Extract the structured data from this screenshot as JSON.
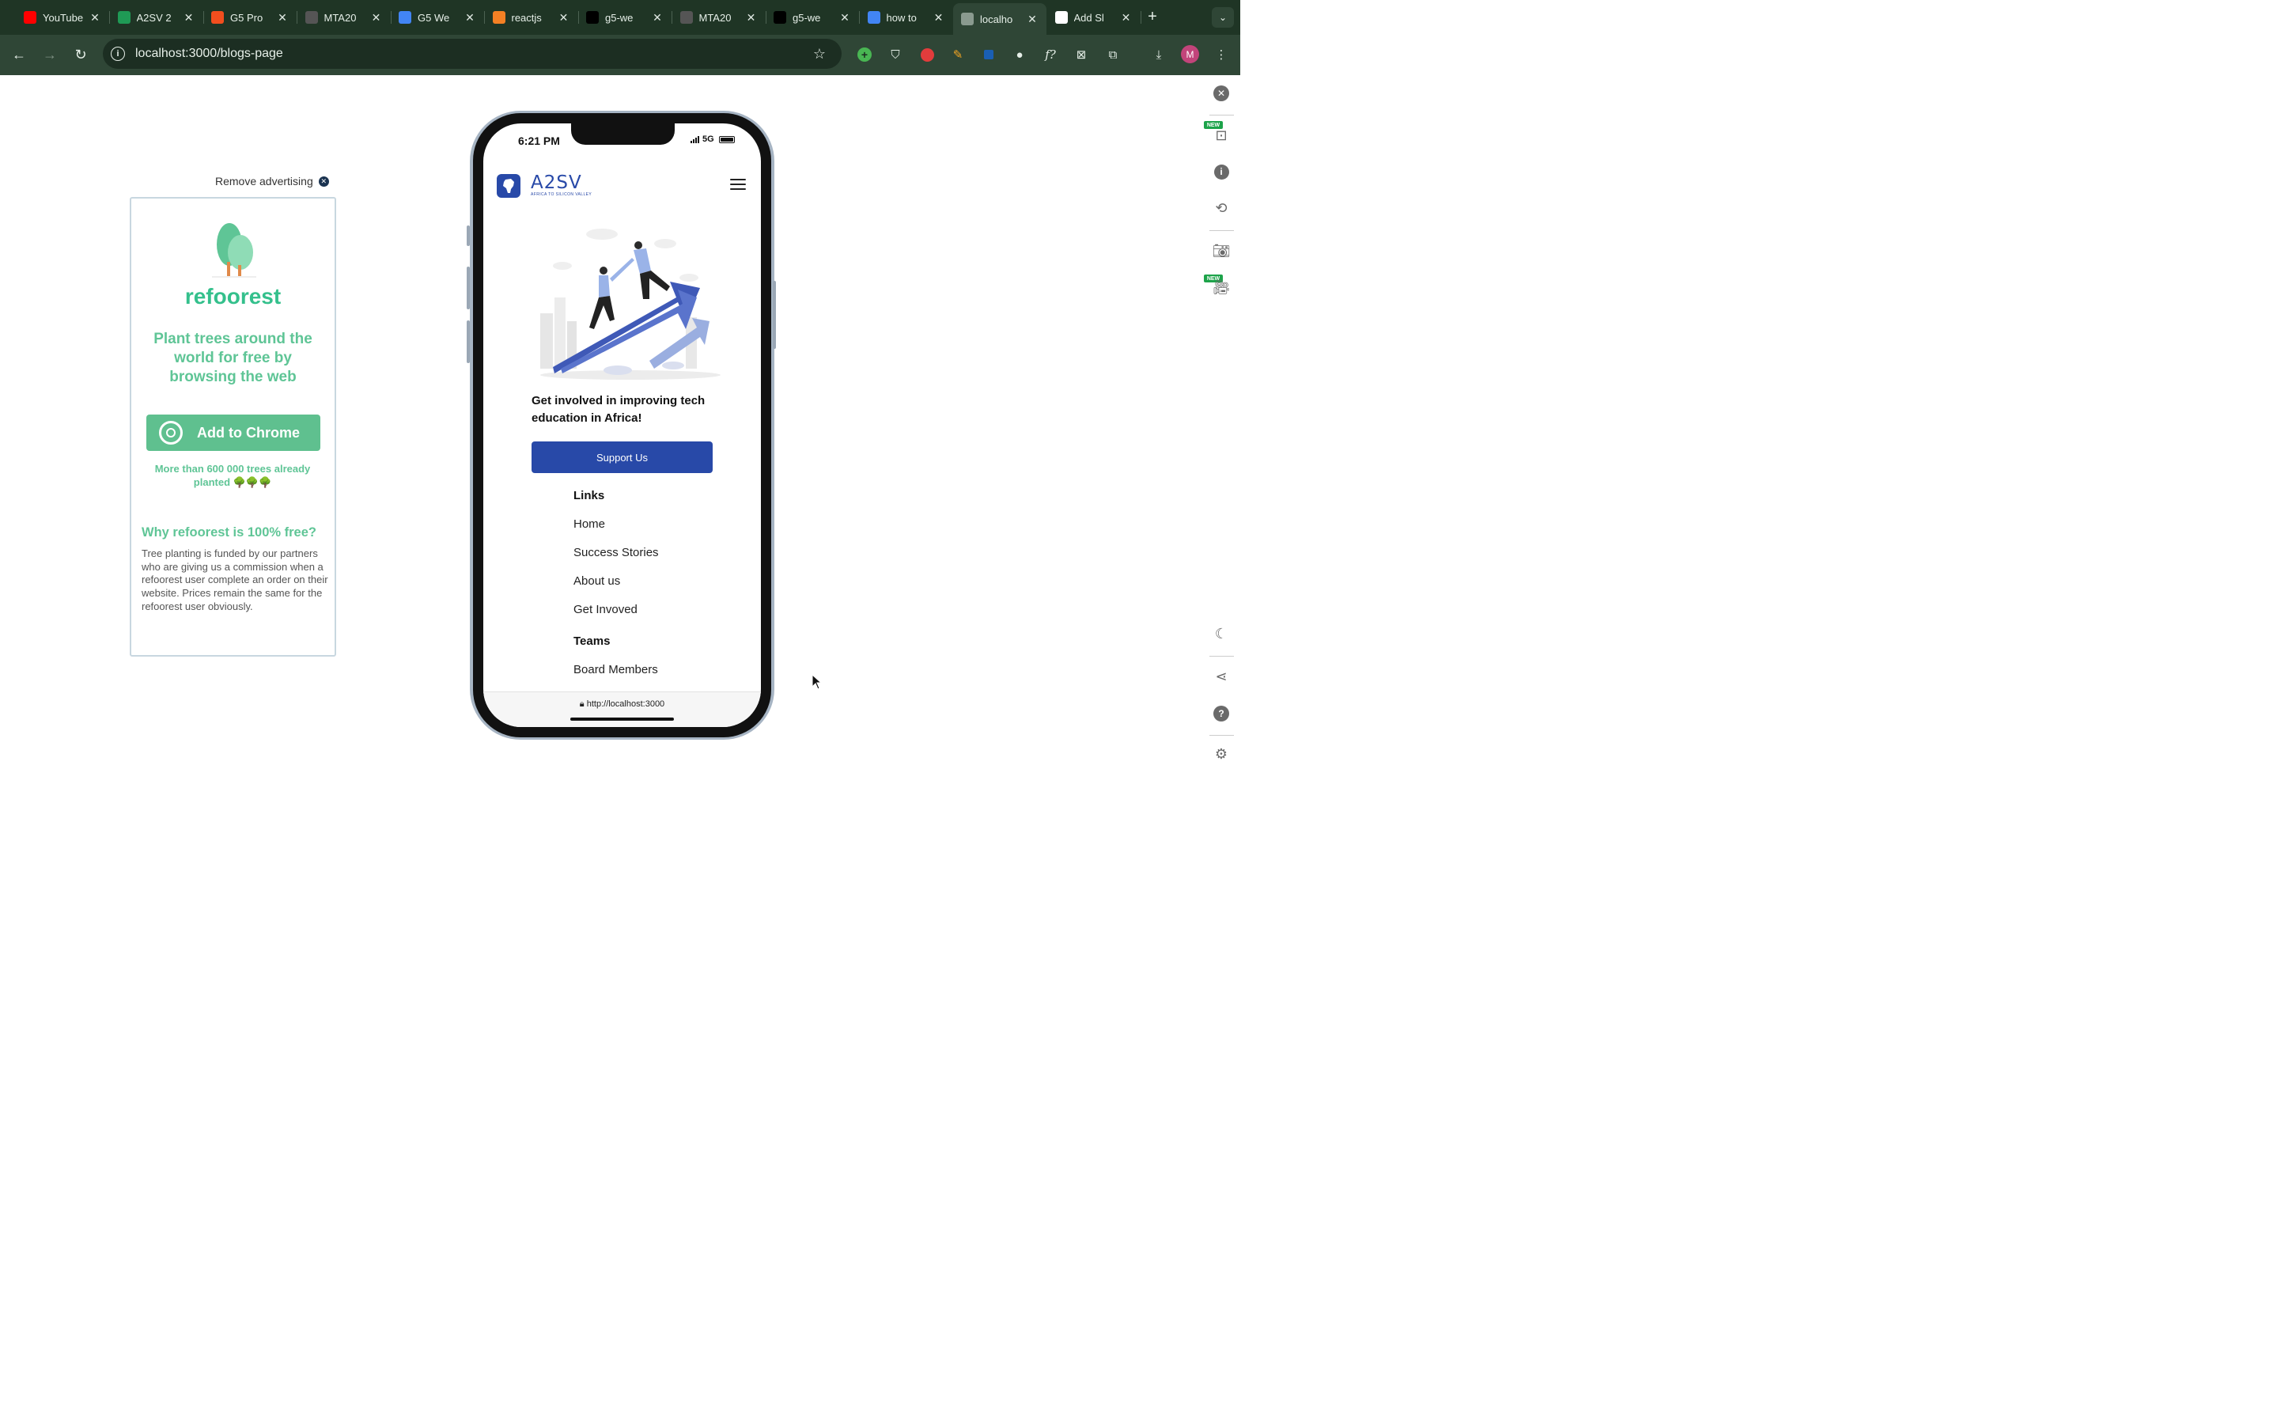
{
  "browser": {
    "tabs": [
      {
        "label": "YouTube",
        "favicon": "youtube-icon",
        "color": "#ff0000"
      },
      {
        "label": "A2SV 2",
        "favicon": "a2sv-icon",
        "color": "#1f9a55"
      },
      {
        "label": "G5 Pro",
        "favicon": "figma-icon",
        "color": "#f24e1e"
      },
      {
        "label": "MTA20",
        "favicon": "github-icon",
        "color": "#555555"
      },
      {
        "label": "G5 We",
        "favicon": "google-docs-icon",
        "color": "#4285f4"
      },
      {
        "label": "reactjs",
        "favicon": "stackoverflow-icon",
        "color": "#f48024"
      },
      {
        "label": "g5-we",
        "favicon": "vercel-icon",
        "color": "#000000"
      },
      {
        "label": "MTA20",
        "favicon": "github-icon",
        "color": "#555555"
      },
      {
        "label": "g5-we",
        "favicon": "vercel-icon",
        "color": "#000000"
      },
      {
        "label": "how to",
        "favicon": "google-icon",
        "color": "#4285f4"
      },
      {
        "label": "localho",
        "favicon": "globe-icon",
        "color": "#8a9a8f"
      },
      {
        "label": "Add Sl",
        "favicon": "openai-icon",
        "color": "#ffffff"
      }
    ],
    "active_tab_index": 10,
    "url": "localhost:3000/blogs-page",
    "profile_initial": "M"
  },
  "ad": {
    "remove_label": "Remove advertising",
    "brand": "refoorest",
    "headline": "Plant trees around the world for free by browsing the web",
    "cta": "Add to Chrome",
    "sub": "More than 600 000 trees already planted 🌳🌳🌳",
    "why_title": "Why refoorest is 100% free?",
    "why_body": "Tree planting is funded by our partners who are giving us a commission when a refoorest user complete an order on their website. Prices remain the same for the refoorest user obviously."
  },
  "phone": {
    "time": "6:21 PM",
    "network": "5G",
    "logo_text": "A2SV",
    "logo_tagline": "AFRICA TO SILICON VALLEY",
    "tagline": "Get involved in improving tech education in Africa!",
    "support_button": "Support Us",
    "links_heading": "Links",
    "links": [
      "Home",
      "Success Stories",
      "About us",
      "Get Invoved"
    ],
    "teams_heading": "Teams",
    "teams": [
      "Board Members"
    ],
    "bottom_url": "http://localhost:3000"
  },
  "side_panel": {
    "badge": "NEW"
  }
}
